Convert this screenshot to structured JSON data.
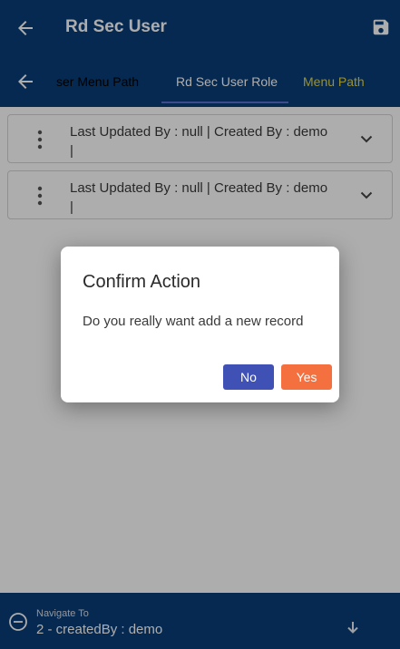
{
  "app_bar": {
    "title": "Rd Sec User",
    "back_icon": "arrow-left-icon",
    "save_icon": "save-icon"
  },
  "tabs": {
    "back_icon": "arrow-left-icon",
    "items": [
      {
        "label": "ser Menu Path",
        "active": false
      },
      {
        "label": "Rd Sec User Role",
        "active": true
      },
      {
        "label": "Menu Path",
        "active": false
      }
    ]
  },
  "records": [
    {
      "text": "Last Updated By  : null | Created By  : demo |"
    },
    {
      "text": "Last Updated By  : null | Created By  : demo |"
    }
  ],
  "navigate": {
    "label": "Navigate To",
    "value": "2 - createdBy : demo"
  },
  "dialog": {
    "title": "Confirm Action",
    "message": "Do you really want add a new record",
    "no_label": "No",
    "yes_label": "Yes"
  },
  "colors": {
    "primary": "#0a3d78",
    "tab_inactive": "#e2d54a",
    "no_button": "#3f51b5",
    "yes_button": "#f4713f"
  }
}
